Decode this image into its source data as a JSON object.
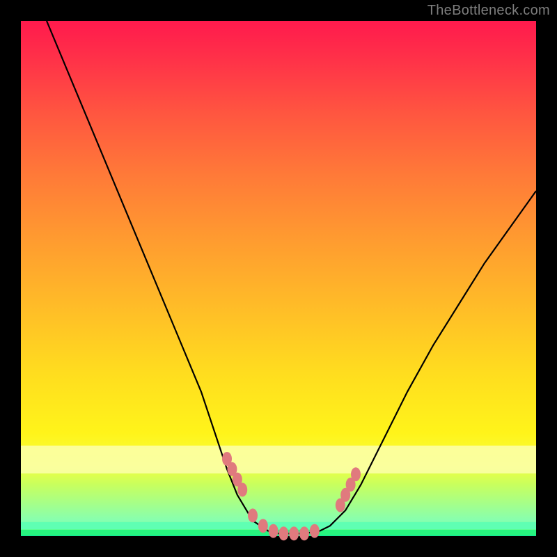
{
  "watermark": "TheBottleneck.com",
  "colors": {
    "frame": "#000000",
    "curve": "#000000",
    "dot": "#e07a7e",
    "gradient_top": "#ff1a4d",
    "gradient_bottom": "#27f57f"
  },
  "chart_data": {
    "type": "line",
    "title": "",
    "xlabel": "",
    "ylabel": "",
    "xlim": [
      0,
      100
    ],
    "ylim": [
      0,
      100
    ],
    "note": "No axis tick labels or numeric values are printed in the image; curve describes a V-shaped bottleneck profile where y≈0 is optimal (green) and y≈100 is worst (red). Values below are pixel-estimated percentages.",
    "series": [
      {
        "name": "bottleneck-curve",
        "x": [
          5,
          10,
          15,
          20,
          25,
          30,
          35,
          40,
          42,
          45,
          48,
          50,
          52,
          55,
          58,
          60,
          63,
          66,
          70,
          75,
          80,
          85,
          90,
          95,
          100
        ],
        "y": [
          100,
          88,
          76,
          64,
          52,
          40,
          28,
          13,
          8,
          3,
          1,
          0.5,
          0.5,
          0.5,
          1,
          2,
          5,
          10,
          18,
          28,
          37,
          45,
          53,
          60,
          67
        ]
      }
    ],
    "highlight_points": {
      "name": "salmon-dots",
      "x": [
        40,
        41,
        42,
        43,
        45,
        47,
        49,
        51,
        53,
        55,
        57,
        62,
        63,
        64,
        65
      ],
      "y": [
        15,
        13,
        11,
        9,
        4,
        2,
        1,
        0.5,
        0.5,
        0.5,
        1,
        6,
        8,
        10,
        12
      ]
    },
    "background_bands": [
      {
        "name": "pale-yellow-band",
        "y_from": 13,
        "y_to": 18
      },
      {
        "name": "green-floor",
        "y_from": 0,
        "y_to": 1.3
      }
    ]
  }
}
